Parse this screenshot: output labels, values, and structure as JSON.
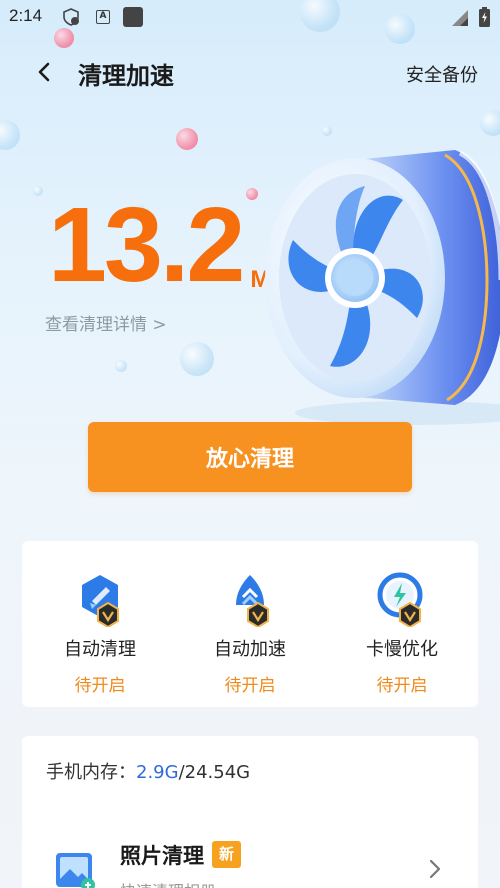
{
  "status_bar": {
    "time": "2:14",
    "icons": [
      "shield-badge-icon",
      "a-letter-icon",
      "square-app-icon",
      "signal-icon",
      "battery-charging-icon"
    ],
    "a_letter": "A"
  },
  "header": {
    "title": "清理加速",
    "action_label": "安全备份",
    "back_icon": "chevron-left-icon"
  },
  "hero": {
    "size_value": "13.2",
    "size_unit": "M",
    "detail_link": "查看清理详情 >",
    "illustration": "fan-icon"
  },
  "main_button": {
    "label": "放心清理"
  },
  "features": [
    {
      "label": "自动清理",
      "status": "待开启",
      "icon": "auto-clean-icon"
    },
    {
      "label": "自动加速",
      "status": "待开启",
      "icon": "auto-speed-icon"
    },
    {
      "label": "卡慢优化",
      "status": "待开启",
      "icon": "lag-optimize-icon"
    }
  ],
  "memory": {
    "label": "手机内存：",
    "used": "2.9G",
    "total": "/24.54G"
  },
  "photo_clean": {
    "title": "照片清理",
    "badge": "新",
    "subtitle": "快速清理相册",
    "icon": "photo-icon"
  },
  "colors": {
    "accent_orange": "#f66f0c",
    "button_orange": "#f7911f",
    "status_orange": "#f08a1a",
    "link_blue": "#2e6bd9",
    "fan_blue": "#3d86ee"
  }
}
